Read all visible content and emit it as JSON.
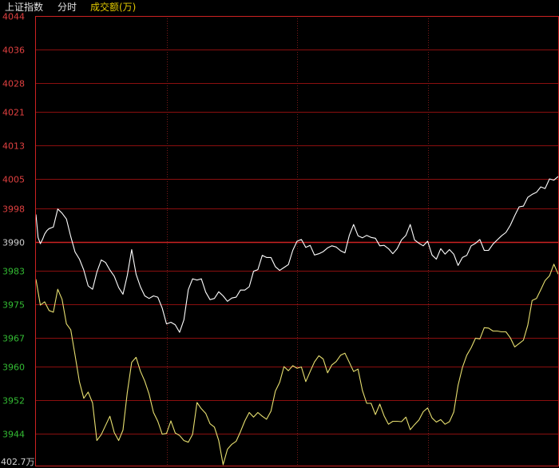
{
  "header": {
    "index_name": "上证指数",
    "mode": "分时",
    "metric": "成交额(万)"
  },
  "colors": {
    "background": "#000000",
    "grid_red": "#8b0f0f",
    "grid_dotted": "#7a1a1a",
    "axis_frame": "#cc2222",
    "up_red": "#e04040",
    "down_green": "#33bb33",
    "neutral_label": "#d0d0d0",
    "price_line": "#ffffff",
    "avg_line": "#e8e070",
    "header_white": "#e0e0e0",
    "header_yellow": "#e0c800"
  },
  "chart_data": {
    "type": "line",
    "title": "",
    "xlabel": "",
    "ylabel": "",
    "ylim": [
      3936.2,
      4044
    ],
    "baseline": 3990,
    "y_ticks": [
      {
        "label": "4044",
        "value": 4044,
        "color": "up"
      },
      {
        "label": "4036",
        "value": 4036,
        "color": "up"
      },
      {
        "label": "4028",
        "value": 4028,
        "color": "up"
      },
      {
        "label": "4021",
        "value": 4021,
        "color": "up"
      },
      {
        "label": "4013",
        "value": 4013,
        "color": "up"
      },
      {
        "label": "4005",
        "value": 4005,
        "color": "up"
      },
      {
        "label": "3998",
        "value": 3998,
        "color": "up"
      },
      {
        "label": "3990",
        "value": 3990,
        "color": "neutral"
      },
      {
        "label": "3983",
        "value": 3983,
        "color": "down"
      },
      {
        "label": "3975",
        "value": 3975,
        "color": "down"
      },
      {
        "label": "3967",
        "value": 3967,
        "color": "down"
      },
      {
        "label": "3960",
        "value": 3960,
        "color": "down"
      },
      {
        "label": "3952",
        "value": 3952,
        "color": "down"
      },
      {
        "label": "3944",
        "value": 3944,
        "color": "down"
      }
    ],
    "volume_label": "402.7万",
    "x_range": [
      0,
      240
    ],
    "x_vertical_dividers": [
      60,
      120,
      180
    ],
    "series": [
      {
        "key": "price",
        "color": "#ffffff",
        "x": [
          0,
          1,
          2,
          3,
          4,
          5,
          6,
          7,
          8,
          10,
          12,
          14,
          16,
          18,
          20,
          22,
          24,
          26,
          28,
          30,
          32,
          34,
          36,
          38,
          40,
          42,
          44,
          46,
          48,
          50,
          52,
          54,
          56,
          58,
          60,
          62,
          64,
          66,
          68,
          70,
          72,
          74,
          76,
          78,
          80,
          82,
          84,
          86,
          88,
          90,
          92,
          94,
          96,
          98,
          100,
          102,
          104,
          106,
          108,
          110,
          112,
          114,
          116,
          118,
          120,
          122,
          124,
          126,
          128,
          130,
          132,
          134,
          136,
          138,
          140,
          142,
          144,
          146,
          148,
          150,
          152,
          154,
          156,
          158,
          160,
          162,
          164,
          166,
          168,
          170,
          172,
          174,
          176,
          178,
          180,
          182,
          184,
          186,
          188,
          190,
          192,
          194,
          196,
          198,
          200,
          202,
          204,
          206,
          208,
          210,
          212,
          214,
          216,
          218,
          220,
          222,
          224,
          226,
          228,
          230,
          232,
          234,
          236,
          238,
          240
        ],
        "values": [
          3996.5,
          3991,
          3989.5,
          3990.5,
          3991.8,
          3992.6,
          3993.1,
          3993.3,
          3993.5,
          3997.8,
          3996.8,
          3995.4,
          3991.2,
          3987.5,
          3985.8,
          3983.2,
          3979.4,
          3978.6,
          3982.7,
          3985.6,
          3985,
          3983.2,
          3981.7,
          3979,
          3977.4,
          3981.9,
          3988.1,
          3982.2,
          3979.2,
          3977,
          3976.4,
          3977,
          3976.7,
          3974.1,
          3970.3,
          3970.7,
          3970.1,
          3968.3,
          3971.3,
          3978.5,
          3981.1,
          3980.8,
          3981.1,
          3977.9,
          3976.1,
          3976.4,
          3978,
          3977,
          3975.7,
          3976.5,
          3976.7,
          3978.4,
          3978.4,
          3979.2,
          3982.9,
          3983.3,
          3986.7,
          3986.2,
          3986.2,
          3984,
          3983.1,
          3983.8,
          3984.5,
          3987.9,
          3990.1,
          3990.5,
          3988.6,
          3989.1,
          3986.8,
          3987.1,
          3987.6,
          3988.5,
          3989,
          3988.7,
          3987.8,
          3987.3,
          3991.5,
          3994.1,
          3991.4,
          3990.9,
          3991.5,
          3991,
          3990.8,
          3989,
          3989.1,
          3988.3,
          3987.1,
          3988.3,
          3990.4,
          3991.5,
          3994.1,
          3990.4,
          3989.6,
          3989,
          3990.1,
          3986.8,
          3985.8,
          3988.3,
          3987,
          3988.1,
          3987,
          3984.3,
          3986.2,
          3986.7,
          3989,
          3989.6,
          3990.5,
          3987.9,
          3987.9,
          3989.4,
          3990.4,
          3991.4,
          3992.2,
          3993.9,
          3996.2,
          3998.3,
          3998.5,
          4000.6,
          4001.3,
          4001.8,
          4003.1,
          4002.7,
          4005,
          4004.7,
          4005.6
        ]
      },
      {
        "key": "average",
        "color": "#e8e070",
        "x": [
          0,
          2,
          4,
          6,
          8,
          10,
          12,
          14,
          16,
          18,
          20,
          22,
          24,
          26,
          28,
          30,
          32,
          34,
          36,
          38,
          40,
          42,
          44,
          46,
          48,
          50,
          52,
          54,
          56,
          58,
          60,
          62,
          64,
          66,
          68,
          70,
          72,
          74,
          76,
          78,
          80,
          82,
          84,
          86,
          88,
          90,
          92,
          94,
          96,
          98,
          100,
          102,
          104,
          106,
          108,
          110,
          112,
          114,
          116,
          118,
          120,
          122,
          124,
          126,
          128,
          130,
          132,
          134,
          136,
          138,
          140,
          142,
          144,
          146,
          148,
          150,
          152,
          154,
          156,
          158,
          160,
          162,
          164,
          166,
          168,
          170,
          172,
          174,
          176,
          178,
          180,
          182,
          184,
          186,
          188,
          190,
          192,
          194,
          196,
          198,
          200,
          202,
          204,
          206,
          208,
          210,
          212,
          214,
          216,
          218,
          220,
          222,
          224,
          226,
          228,
          230,
          232,
          234,
          236,
          238,
          240
        ],
        "values": [
          3981,
          3974.8,
          3975.6,
          3973.5,
          3973.1,
          3978.6,
          3976.2,
          3970.3,
          3968.9,
          3962.8,
          3956.4,
          3952.5,
          3954,
          3951.4,
          3942.4,
          3943.8,
          3946,
          3948.2,
          3944.3,
          3942.4,
          3944.9,
          3953.9,
          3961.1,
          3962.3,
          3959,
          3956.6,
          3953.5,
          3949.1,
          3947,
          3943.9,
          3944.1,
          3947.1,
          3944.2,
          3943.6,
          3942.4,
          3942,
          3943.9,
          3951.5,
          3950,
          3948.9,
          3946.4,
          3945.6,
          3942.4,
          3936.6,
          3940.3,
          3941.5,
          3942.2,
          3944.5,
          3947.1,
          3949.1,
          3948,
          3949.1,
          3948.2,
          3947.5,
          3949.4,
          3954.2,
          3956.3,
          3960.1,
          3959.1,
          3960.3,
          3959.7,
          3960,
          3956.5,
          3958.9,
          3961.2,
          3962.7,
          3961.9,
          3958.6,
          3960.5,
          3961.3,
          3962.8,
          3963.3,
          3961.1,
          3958.9,
          3959.5,
          3954.4,
          3951.3,
          3951.3,
          3948.6,
          3951.1,
          3948.3,
          3946.3,
          3947,
          3947,
          3946.9,
          3948,
          3945,
          3946.2,
          3947.3,
          3949.3,
          3950.2,
          3947.8,
          3946.8,
          3947.4,
          3946.3,
          3946.9,
          3949.2,
          3955.6,
          3959.9,
          3962.8,
          3964.6,
          3966.9,
          3966.7,
          3969.4,
          3969.3,
          3968.6,
          3968.6,
          3968.4,
          3968.4,
          3967,
          3964.8,
          3965.6,
          3966.4,
          3970,
          3975.9,
          3976.4,
          3978.5,
          3980.7,
          3981.8,
          3984.6,
          3982.2
        ]
      }
    ]
  }
}
